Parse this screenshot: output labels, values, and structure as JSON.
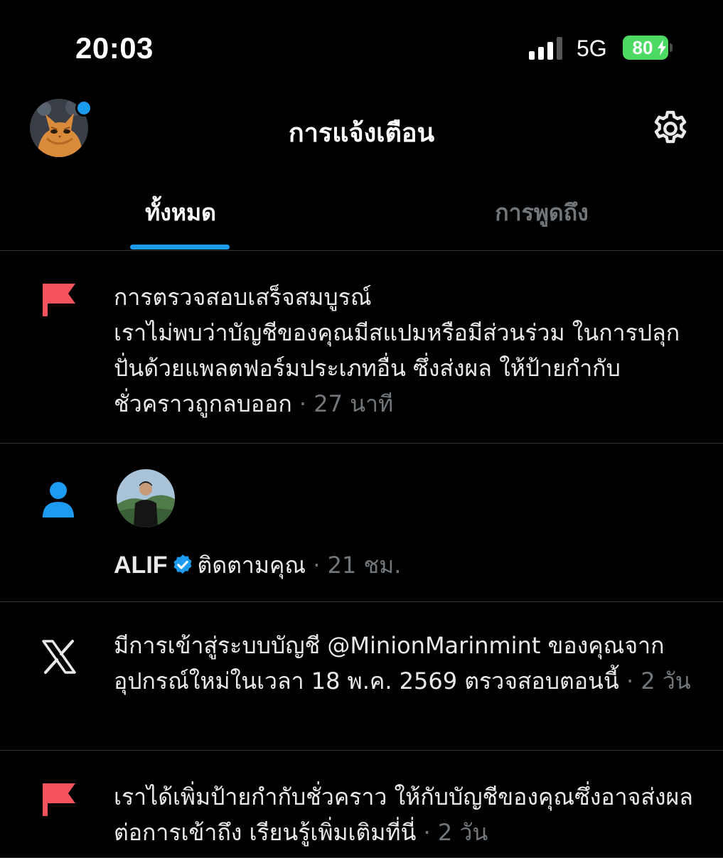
{
  "status_bar": {
    "time": "20:03",
    "network": "5G",
    "battery": "80"
  },
  "header": {
    "title": "การแจ้งเตือน"
  },
  "tabs": [
    {
      "label": "ทั้งหมด",
      "active": true
    },
    {
      "label": "การพูดถึง",
      "active": false
    }
  ],
  "colors": {
    "accent": "#1d9bf0",
    "flag": "#f4212e",
    "muted": "#71767b",
    "battery": "#4cd964"
  },
  "notifications": [
    {
      "icon": "flag-icon",
      "title": "การตรวจสอบเสร็จสมบูรณ์",
      "text": "เราไม่พบว่าบัญชีของคุณมีสแปมหรือมีส่วนร่วม ในการปลุกปั่นด้วยแพลตฟอร์มประเภทอื่น ซึ่งส่งผล ให้ป้ายกำกับชั่วคราวถูกลบออก",
      "time": "· 27 นาที"
    },
    {
      "icon": "person-icon",
      "user": "ALIF",
      "action": "ติดตามคุณ",
      "time": "· 21 ชม."
    },
    {
      "icon": "x-logo-icon",
      "text": "มีการเข้าสู่ระบบบัญชี @MinionMarinmint ของคุณจากอุปกรณ์ใหม่ในเวลา 18 พ.ค. 2569 ตรวจสอบตอนนี้",
      "time": "· 2 วัน"
    },
    {
      "icon": "flag-icon",
      "text": "เราได้เพิ่มป้ายกำกับชั่วคราว ให้กับบัญชีของคุณซึ่งอาจส่งผลต่อการเข้าถึง เรียนรู้เพิ่มเติมที่นี่",
      "time": "· 2 วัน"
    }
  ]
}
